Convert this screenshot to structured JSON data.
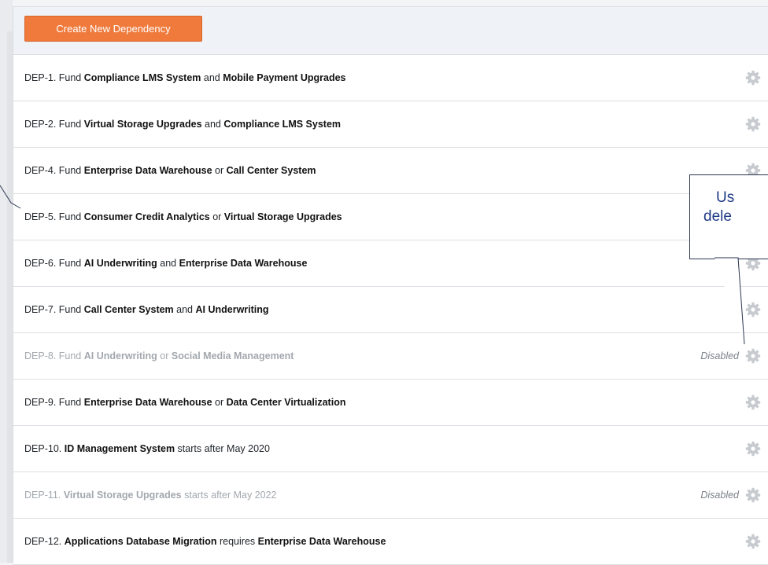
{
  "toolbar": {
    "create_label": "Create New Dependency"
  },
  "callout": {
    "line1": "Us",
    "line2": "dele"
  },
  "rows": [
    {
      "id": "DEP-1.",
      "parts": [
        " Fund ",
        "Compliance LMS System",
        " and ",
        "Mobile Payment Upgrades",
        ""
      ],
      "status": ""
    },
    {
      "id": "DEP-2.",
      "parts": [
        " Fund ",
        "Virtual Storage Upgrades",
        " and ",
        "Compliance LMS System",
        ""
      ],
      "status": ""
    },
    {
      "id": "DEP-4.",
      "parts": [
        " Fund ",
        "Enterprise Data Warehouse",
        " or ",
        "Call Center System",
        ""
      ],
      "status": ""
    },
    {
      "id": "DEP-5.",
      "parts": [
        " Fund ",
        "Consumer Credit Analytics",
        " or ",
        "Virtual Storage Upgrades",
        ""
      ],
      "status": ""
    },
    {
      "id": "DEP-6.",
      "parts": [
        " Fund ",
        "AI Underwriting",
        " and ",
        "Enterprise Data Warehouse",
        ""
      ],
      "status": ""
    },
    {
      "id": "DEP-7.",
      "parts": [
        " Fund ",
        "Call Center System",
        " and ",
        "AI Underwriting",
        ""
      ],
      "status": ""
    },
    {
      "id": "DEP-8.",
      "parts": [
        " Fund ",
        "AI Underwriting",
        " or ",
        "Social Media Management",
        ""
      ],
      "status": "Disabled"
    },
    {
      "id": "DEP-9.",
      "parts": [
        " Fund ",
        "Enterprise Data Warehouse",
        " or ",
        "Data Center Virtualization",
        ""
      ],
      "status": ""
    },
    {
      "id": "DEP-10.",
      "parts": [
        " ",
        "ID Management System",
        " starts after May 2020",
        "",
        ""
      ],
      "status": ""
    },
    {
      "id": "DEP-11.",
      "parts": [
        " ",
        "Virtual Storage Upgrades",
        " starts after May 2022",
        "",
        ""
      ],
      "status": "Disabled"
    },
    {
      "id": "DEP-12.",
      "parts": [
        " ",
        "Applications Database Migration",
        " requires ",
        "Enterprise Data Warehouse",
        ""
      ],
      "status": ""
    }
  ]
}
